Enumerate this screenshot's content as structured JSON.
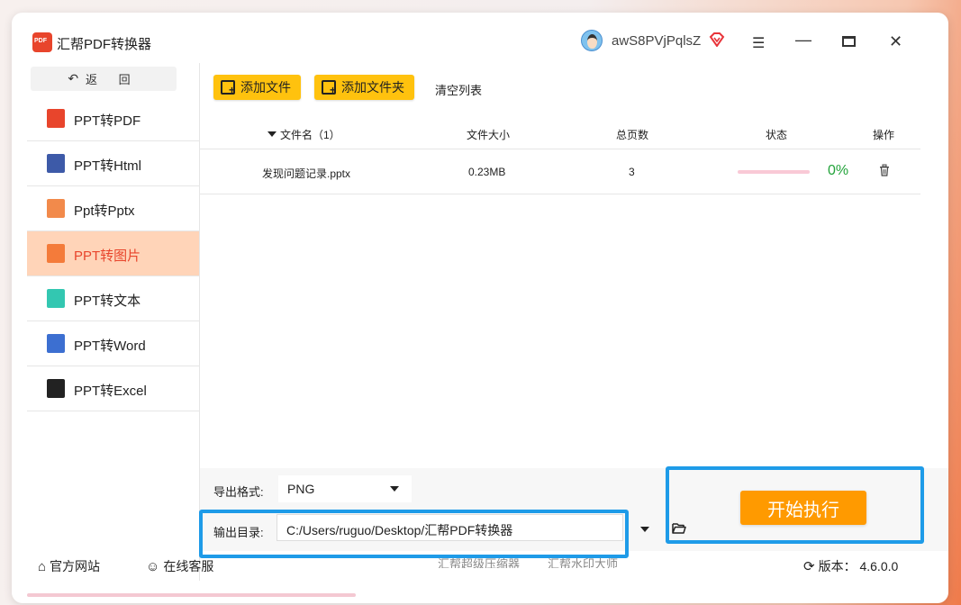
{
  "app": {
    "title": "汇帮PDF转换器",
    "username": "awS8PVjPqlsZ",
    "logo_text": "PDF"
  },
  "window_controls": {
    "menu_icon": "hamburger-menu-icon",
    "minimize_icon": "minimize-icon",
    "maximize_icon": "maximize-icon",
    "close_icon": "close-icon"
  },
  "sidebar": {
    "back_label": "返 回",
    "items": [
      {
        "label": "PPT转PDF",
        "icon": "pdf-icon",
        "color": "#e8452c",
        "active": false
      },
      {
        "label": "PPT转Html",
        "icon": "html-icon",
        "color": "#3d5aa8",
        "active": false
      },
      {
        "label": "Ppt转Pptx",
        "icon": "pptx-icon",
        "color": "#f28a4b",
        "active": false
      },
      {
        "label": "PPT转图片",
        "icon": "image-icon",
        "color": "#f47b3a",
        "active": true
      },
      {
        "label": "PPT转文本",
        "icon": "text-icon",
        "color": "#33c7b1",
        "active": false
      },
      {
        "label": "PPT转Word",
        "icon": "word-icon",
        "color": "#3c6fd1",
        "active": false
      },
      {
        "label": "PPT转Excel",
        "icon": "gif-icon",
        "color": "#222222",
        "active": false
      }
    ]
  },
  "toolbar": {
    "add_file": "添加文件",
    "add_folder": "添加文件夹",
    "clear_list": "清空列表"
  },
  "table": {
    "headers": {
      "name": "文件名（1）",
      "size": "文件大小",
      "pages": "总页数",
      "status": "状态",
      "action": "操作"
    },
    "rows": [
      {
        "name": "发现问题记录.pptx",
        "size": "0.23MB",
        "pages": "3",
        "progress": 0,
        "percent": "0%"
      }
    ]
  },
  "output": {
    "format_label": "导出格式:",
    "format_value": "PNG",
    "dir_label": "输出目录:",
    "dir_value": "C:/Users/ruguo/Desktop/汇帮PDF转换器",
    "start_label": "开始执行"
  },
  "footer": {
    "website": "官方网站",
    "service": "在线客服",
    "link1": "汇帮超级压缩器",
    "link2": "汇帮水印大师",
    "version": "版本： 4.6.0.0"
  },
  "colors": {
    "accent_yellow": "#ffc20e",
    "start_orange": "#ff9a00",
    "highlight_blue": "#1e9be8",
    "active_bg": "#ffd4b8",
    "active_text": "#e8452c",
    "progress_green": "#22a33a"
  }
}
